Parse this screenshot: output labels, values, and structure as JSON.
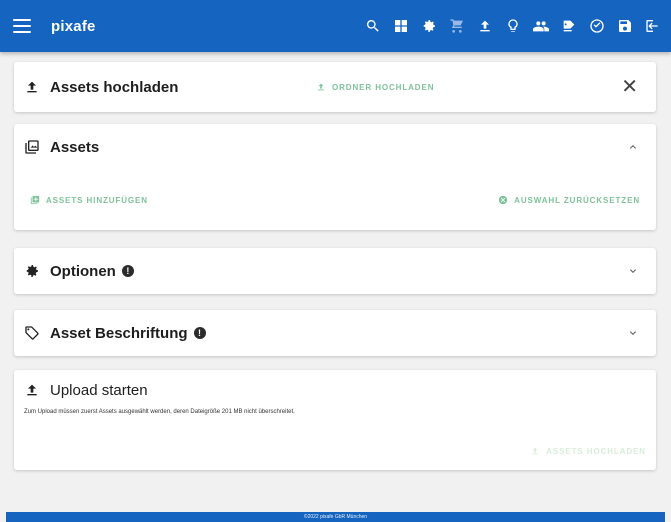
{
  "header": {
    "brand": "pixafe"
  },
  "upload_card": {
    "title": "Assets hochladen",
    "folder_button": "ORDNER HOCHLADEN",
    "close_label": "✕"
  },
  "assets_card": {
    "title": "Assets",
    "add_button": "ASSETS HINZUFÜGEN",
    "reset_button": "AUSWAHL ZURÜCKSETZEN"
  },
  "options_card": {
    "title": "Optionen"
  },
  "caption_card": {
    "title": "Asset Beschriftung"
  },
  "start_card": {
    "title": "Upload starten",
    "note": "Zum Upload müssen zuerst Assets ausgewählt werden, deren Dateigröße 201 MB nicht überschreitet.",
    "upload_button": "ASSETS HOCHLADEN"
  },
  "footer": {
    "text": "©2022 pixafe GbR München"
  },
  "colors": {
    "primary": "#1565c0",
    "accent_green": "#7fc29b",
    "background": "#f1f1f1"
  }
}
